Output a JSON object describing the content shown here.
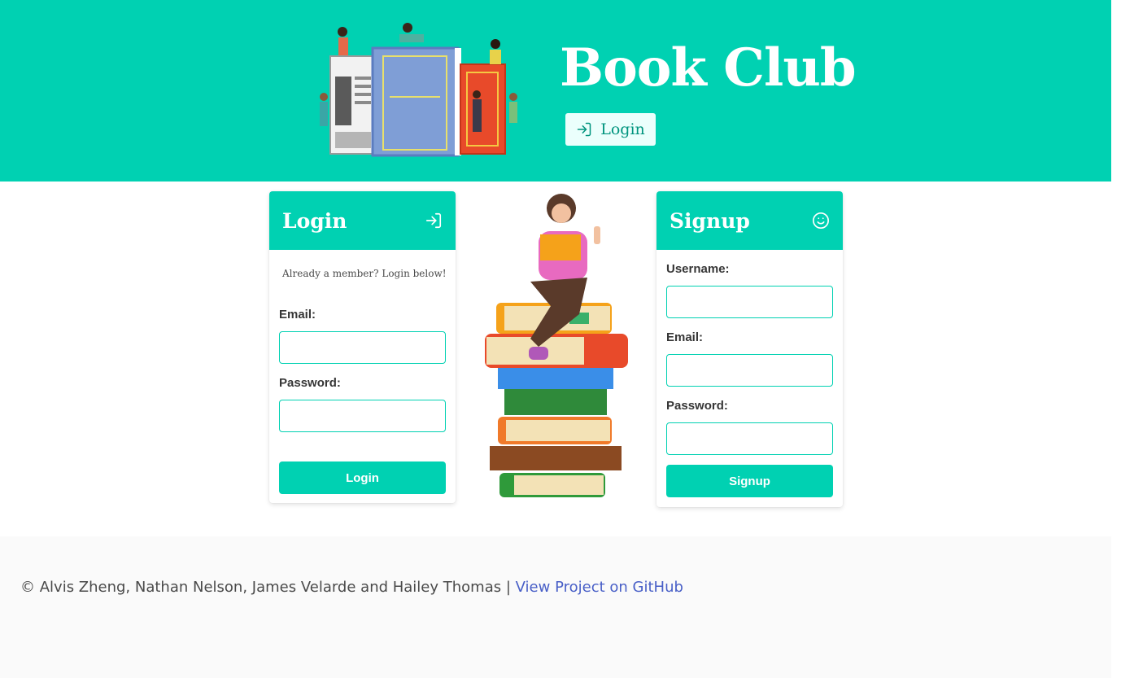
{
  "header": {
    "title": "Book Club",
    "login_label": "Login"
  },
  "login_card": {
    "title": "Login",
    "note": "Already a member? Login below!",
    "email_label": "Email:",
    "email_value": "",
    "password_label": "Password:",
    "password_value": "",
    "submit_label": "Login"
  },
  "signup_card": {
    "title": "Signup",
    "username_label": "Username:",
    "username_value": "",
    "email_label": "Email:",
    "email_value": "",
    "password_label": "Password:",
    "password_value": "",
    "submit_label": "Signup"
  },
  "footer": {
    "credits": "© Alvis Zheng, Nathan Nelson, James Velarde and Hailey Thomas |",
    "link_label": "View Project on GitHub"
  },
  "colors": {
    "primary": "#00d1b2",
    "link": "#485fc7",
    "footer_bg": "#fafafa"
  },
  "icons": {
    "header_login": "sign-in-icon",
    "login_card": "sign-in-icon",
    "signup_card": "smile-icon"
  }
}
